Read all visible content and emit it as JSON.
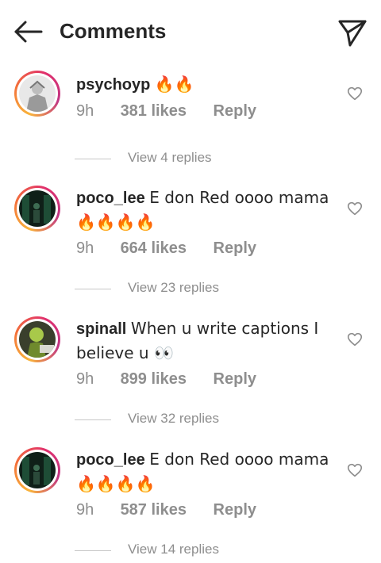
{
  "header": {
    "title": "Comments",
    "back_icon": "arrow-left-icon",
    "send_icon": "paper-plane-icon"
  },
  "comments": [
    {
      "username": "psychoyp",
      "text": "🔥🔥",
      "time": "9h",
      "likes": "381 likes",
      "reply_label": "Reply",
      "view_replies": "View 4 replies"
    },
    {
      "username": "poco_lee",
      "text": "E don Red oooo mama🔥🔥🔥🔥",
      "time": "9h",
      "likes": "664 likes",
      "reply_label": "Reply",
      "view_replies": "View 23 replies"
    },
    {
      "username": "spinall",
      "text": "When u write captions I believe u 👀",
      "time": "9h",
      "likes": "899 likes",
      "reply_label": "Reply",
      "view_replies": "View 32 replies"
    },
    {
      "username": "poco_lee",
      "text": "E don Red oooo mama🔥🔥🔥🔥",
      "time": "9h",
      "likes": "587 likes",
      "reply_label": "Reply",
      "view_replies": "View 14 replies"
    }
  ],
  "colors": {
    "text_primary": "#262626",
    "text_secondary": "#8e8e8e",
    "divider": "#c7c7c7"
  }
}
